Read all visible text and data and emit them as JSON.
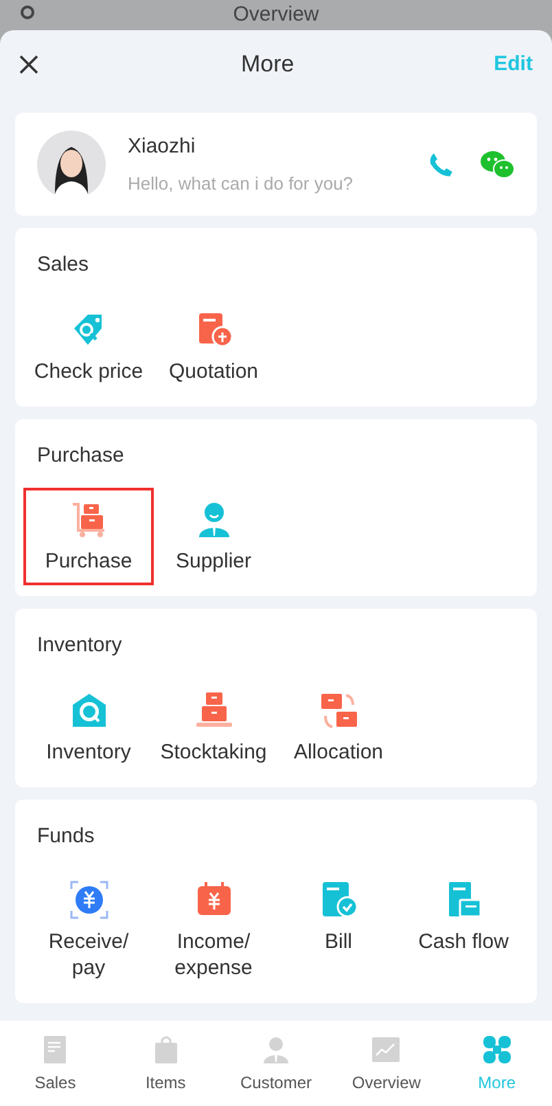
{
  "background_title": "Overview",
  "header": {
    "title": "More",
    "action": "Edit"
  },
  "profile": {
    "name": "Xiaozhi",
    "greeting": "Hello, what can i do for you?"
  },
  "sections": [
    {
      "title": "Sales",
      "items": [
        {
          "label": "Check price",
          "highlighted": false
        },
        {
          "label": "Quotation",
          "highlighted": false
        }
      ]
    },
    {
      "title": "Purchase",
      "items": [
        {
          "label": "Purchase",
          "highlighted": true
        },
        {
          "label": "Supplier",
          "highlighted": false
        }
      ]
    },
    {
      "title": "Inventory",
      "items": [
        {
          "label": "Inventory",
          "highlighted": false
        },
        {
          "label": "Stocktaking",
          "highlighted": false
        },
        {
          "label": "Allocation",
          "highlighted": false
        }
      ]
    },
    {
      "title": "Funds",
      "items": [
        {
          "label": "Receive/ pay",
          "highlighted": false
        },
        {
          "label": "Income/ expense",
          "highlighted": false
        },
        {
          "label": "Bill",
          "highlighted": false
        },
        {
          "label": "Cash flow",
          "highlighted": false
        }
      ]
    }
  ],
  "tabs": [
    {
      "label": "Sales",
      "selected": false
    },
    {
      "label": "Items",
      "selected": false
    },
    {
      "label": "Customer",
      "selected": false
    },
    {
      "label": "Overview",
      "selected": false
    },
    {
      "label": "More",
      "selected": true
    }
  ]
}
